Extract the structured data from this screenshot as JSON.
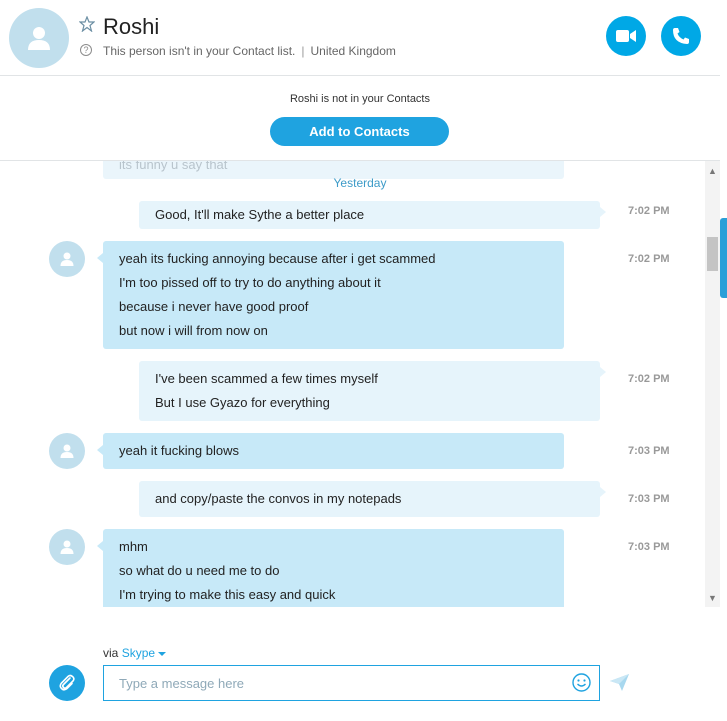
{
  "header": {
    "contact_name": "Roshi",
    "status_text": "This person isn't in your Contact list.",
    "location": "United Kingdom",
    "separator": "|"
  },
  "notice": {
    "text": "Roshi is not in your Contacts",
    "add_button_label": "Add to Contacts"
  },
  "conversation": {
    "faded_text": "its funny u say that",
    "day_label": "Yesterday",
    "messages": [
      {
        "direction": "outgoing",
        "lines": [
          "Good, It'll make Sythe a better place"
        ],
        "time": "7:02 PM"
      },
      {
        "direction": "incoming",
        "lines": [
          "yeah its fucking annoying because after i get scammed",
          "I'm too pissed off to try to do anything about it",
          "because i never have good proof",
          "but now i will from now on"
        ],
        "time": "7:02 PM"
      },
      {
        "direction": "outgoing",
        "lines": [
          "I've been scammed a few times myself",
          "But I use Gyazo for everything"
        ],
        "time": "7:02 PM"
      },
      {
        "direction": "incoming",
        "lines": [
          "yeah it fucking blows"
        ],
        "time": "7:03 PM"
      },
      {
        "direction": "outgoing",
        "lines": [
          "and copy/paste the convos in my notepads"
        ],
        "time": "7:03 PM"
      },
      {
        "direction": "incoming",
        "lines": [
          "mhm",
          "so what do u need me to do",
          "I'm trying to make this easy and quick"
        ],
        "time": "7:03 PM"
      }
    ]
  },
  "compose": {
    "via_label": "via",
    "via_service": "Skype",
    "placeholder": "Type a message here"
  },
  "colors": {
    "accent": "#1fa3e0",
    "incoming_bubble": "#c7e9f8",
    "outgoing_bubble": "#e6f4fb"
  },
  "icons": [
    "star-icon",
    "help-icon",
    "video-call-icon",
    "phone-icon",
    "person-icon",
    "paperclip-icon",
    "emoji-icon",
    "send-icon",
    "chevron-down-icon"
  ]
}
